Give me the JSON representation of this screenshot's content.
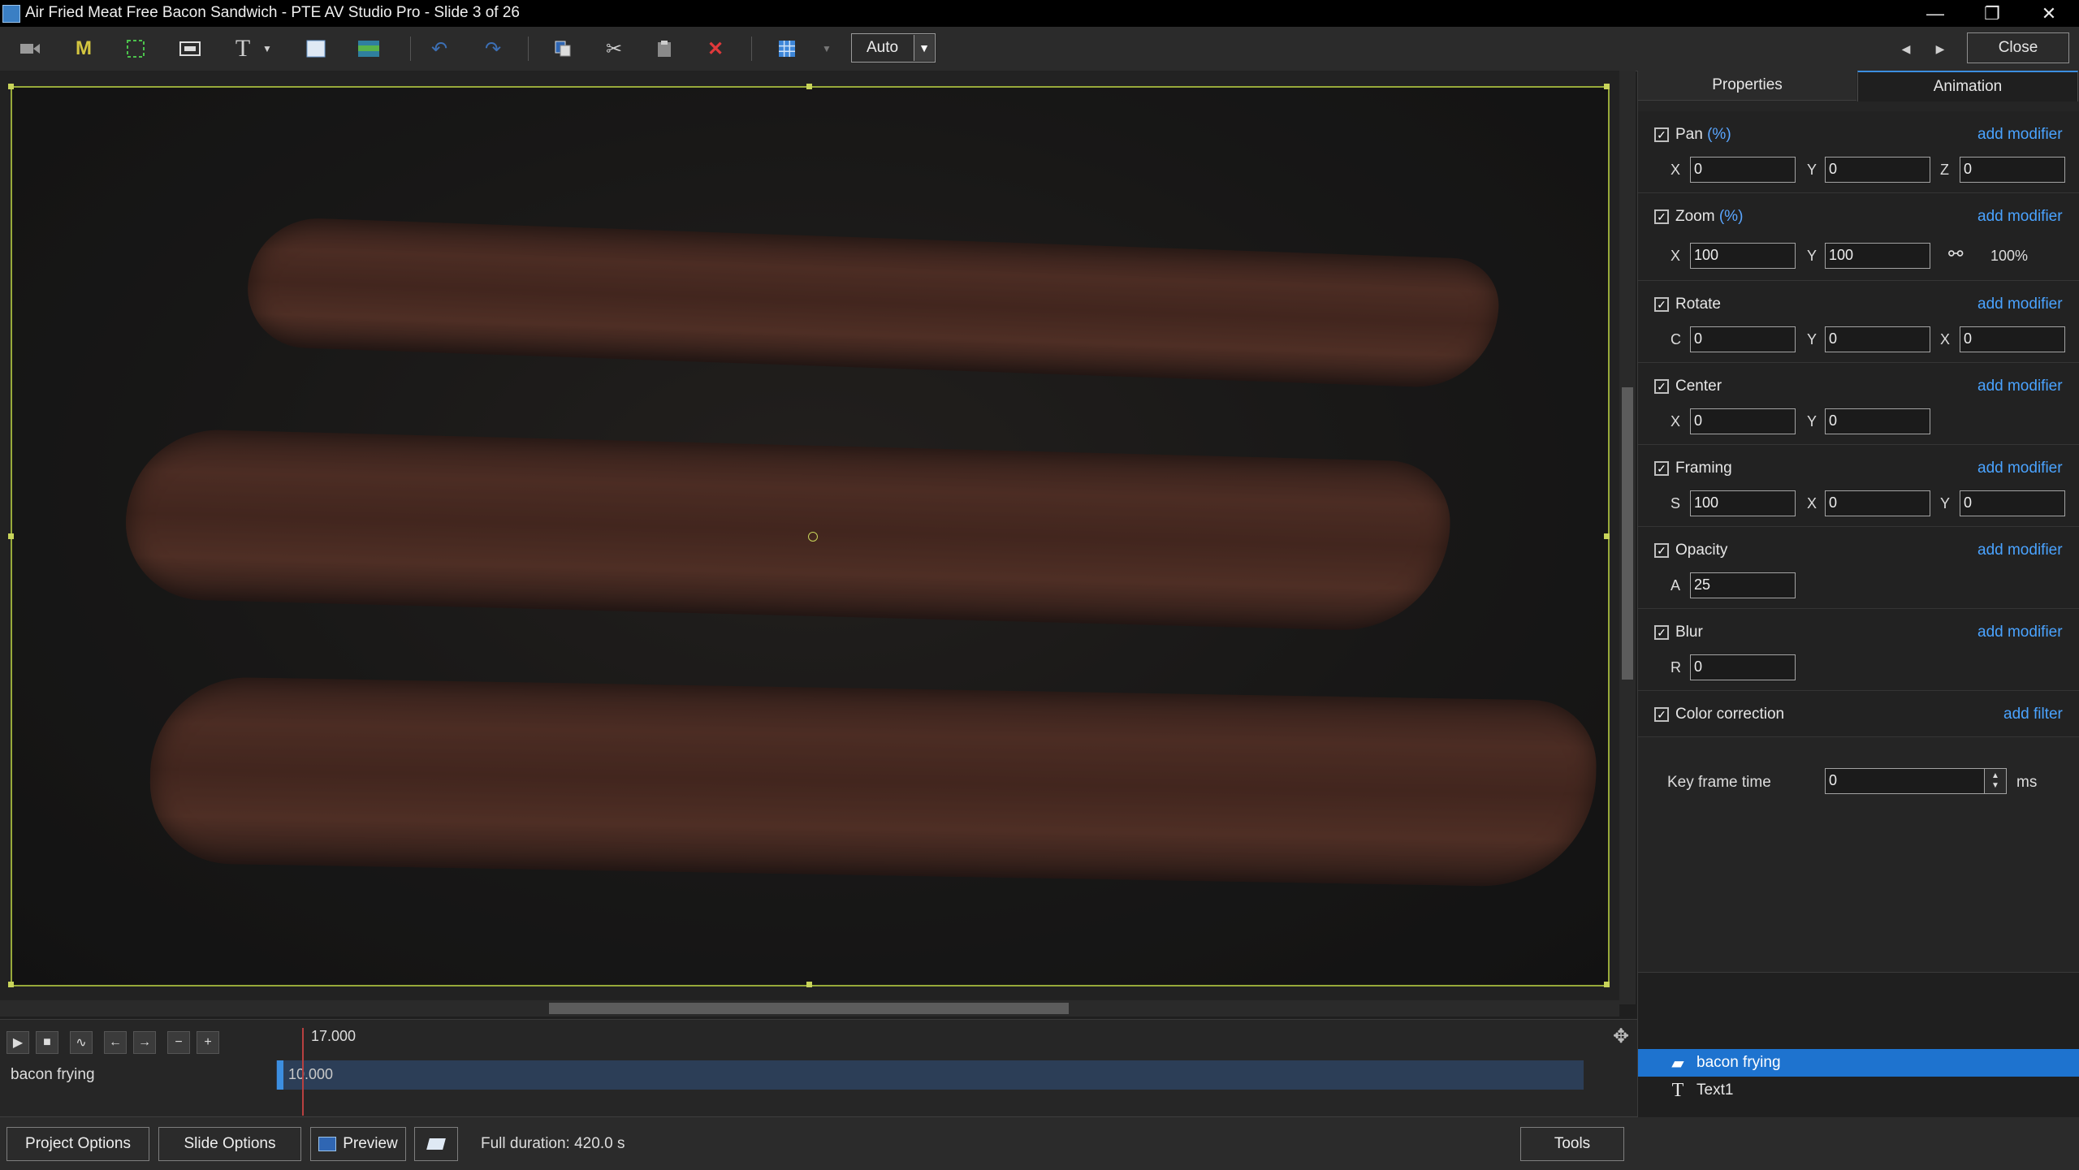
{
  "window": {
    "title": "Air Fried Meat Free Bacon Sandwich - PTE AV Studio Pro - Slide 3 of 26",
    "minimize_glyph": "—",
    "restore_glyph": "❐",
    "close_glyph": "✕"
  },
  "toolbar": {
    "icons": [
      "video-icon",
      "mask-icon",
      "frame-icon",
      "image-icon",
      "text-icon",
      "rectangle-icon",
      "gradient-icon",
      "undo-icon",
      "redo-icon",
      "copy-icon",
      "cut-icon",
      "paste-icon",
      "delete-icon",
      "grid-icon"
    ],
    "zoom_select": "Auto",
    "prev_glyph": "◀",
    "next_glyph": "▶",
    "close_label": "Close"
  },
  "panel": {
    "tabs": [
      "Properties",
      "Animation"
    ],
    "active_tab": "Animation",
    "sections": {
      "pan": {
        "label": "Pan",
        "unit": "(%)",
        "add": "add modifier",
        "axes": [
          "X",
          "Y",
          "Z"
        ],
        "values": [
          "0",
          "0",
          "0"
        ]
      },
      "zoom": {
        "label": "Zoom",
        "unit": "(%)",
        "add": "add modifier",
        "axes": [
          "X",
          "Y"
        ],
        "values": [
          "100",
          "100"
        ],
        "percent": "100%"
      },
      "rotate": {
        "label": "Rotate",
        "add": "add modifier",
        "axes": [
          "C",
          "Y",
          "X"
        ],
        "values": [
          "0",
          "0",
          "0"
        ]
      },
      "center": {
        "label": "Center",
        "add": "add modifier",
        "axes": [
          "X",
          "Y"
        ],
        "values": [
          "0",
          "0"
        ]
      },
      "framing": {
        "label": "Framing",
        "add": "add modifier",
        "axes": [
          "S",
          "X",
          "Y"
        ],
        "values": [
          "100",
          "0",
          "0"
        ]
      },
      "opacity": {
        "label": "Opacity",
        "add": "add modifier",
        "axes": [
          "A"
        ],
        "values": [
          "25"
        ]
      },
      "blur": {
        "label": "Blur",
        "add": "add modifier",
        "axes": [
          "R"
        ],
        "values": [
          "0"
        ]
      },
      "color": {
        "label": "Color correction",
        "add": "add filter"
      }
    },
    "keyframe": {
      "label": "Key frame time",
      "value": "0",
      "unit": "ms"
    },
    "objects": [
      {
        "name": "bacon frying",
        "icon": "video-icon",
        "selected": true
      },
      {
        "name": "Text1",
        "icon": "text-icon",
        "selected": false
      }
    ]
  },
  "timeline": {
    "ruler_time": "17.000",
    "track_label": "bacon frying",
    "track_time": "10.000"
  },
  "bottom": {
    "project_options": "Project Options",
    "slide_options": "Slide Options",
    "preview": "Preview",
    "full_duration": "Full duration: 420.0 s",
    "tools": "Tools"
  },
  "colors": {
    "accent": "#1e73cf",
    "link": "#4aa3ff",
    "frame": "#97a93a"
  }
}
